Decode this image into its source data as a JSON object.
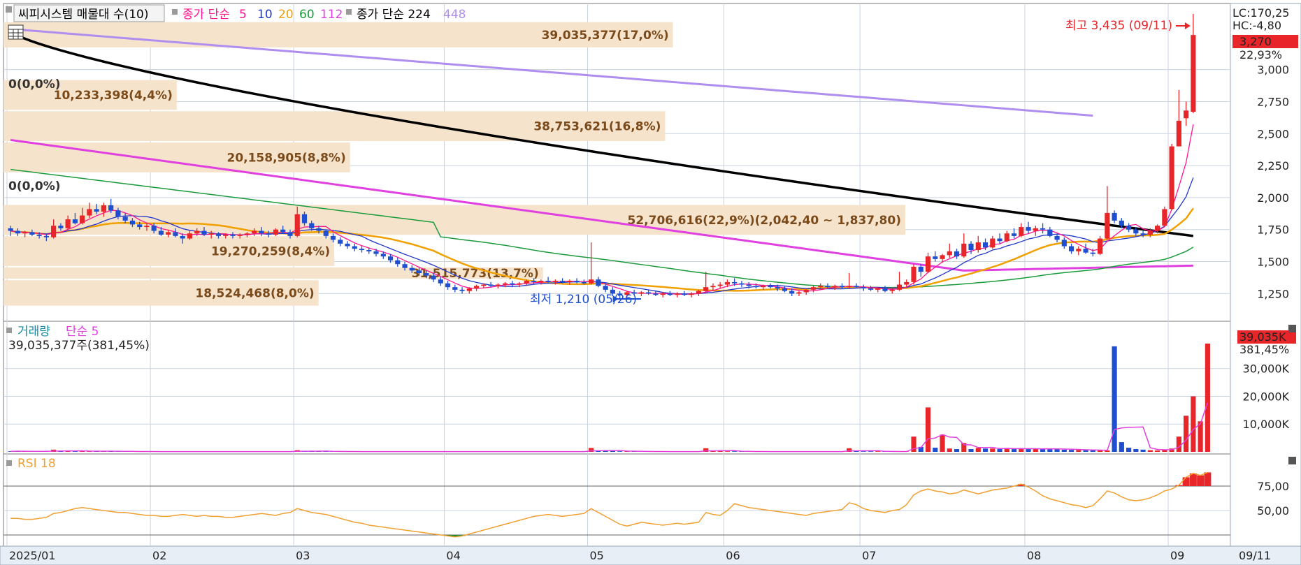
{
  "colors": {
    "up": "#e8262a",
    "down": "#1f4fd1",
    "ma5": "#ff1493",
    "ma10": "#2036c9",
    "ma20": "#f0a000",
    "ma60": "#1a9a3a",
    "ma112": "#e040e0",
    "ma224": "#000000",
    "ma448": "#b08ef0",
    "volume_band": "#f6e3cc",
    "volume_band_text": "#7a4a1a",
    "grid": "#c9d3e0",
    "panel_border": "#7a7a7a",
    "rsi_line": "#f0a030",
    "rsi_overbought": "#e8262a",
    "rsi_oversold": "#1a8a2a",
    "vol_ma": "#e040e0"
  },
  "legend": {
    "indicator": "씨피시스템 매물대 수(10)",
    "ma_prefix": "종가 단순",
    "ma5": "5",
    "ma10": "10",
    "ma20": "20",
    "ma60": "60",
    "ma112": "112",
    "ma224_label": "종가 단순 224",
    "ma448": "448"
  },
  "axis_info": {
    "lc": "LC:170,25",
    "hc": "HC:-4,80",
    "last_price": "3,270",
    "last_change": "22,93%",
    "last_volume": "39,035K",
    "last_volume_ratio": "381,45%"
  },
  "annotations": {
    "high": "최고 3,435 (09/11)",
    "low": "최저 1,210 (05/26)",
    "zero1": "0(0,0%)",
    "zero2": "0(0,0%)"
  },
  "volume_panel": {
    "title_a": "거래량",
    "title_b": "단순 5",
    "summary": "39,035,377주(381,45%)"
  },
  "rsi_panel": {
    "title": "RSI 18"
  },
  "date_label": "09/11",
  "chart_data": {
    "type": "candlestick",
    "ylim": [
      1050,
      3500
    ],
    "y_ticks": [
      "1,250",
      "1,500",
      "1,750",
      "2,000",
      "2,250",
      "2,500",
      "2,750",
      "3,000"
    ],
    "x_ticks": [
      "2025/01",
      "02",
      "03",
      "04",
      "05",
      "06",
      "07",
      "08",
      "09"
    ],
    "x_tick_days": [
      0,
      20,
      40,
      61,
      81,
      100,
      119,
      142,
      162
    ],
    "volume_profile": [
      {
        "lo": 3168,
        "hi": 3376,
        "label": "39,035,377(17,0%)",
        "pct": 17.0
      },
      {
        "lo": 2924,
        "hi": 3168,
        "label": "0(0,0%)",
        "pct": 0.0
      },
      {
        "lo": 2680,
        "hi": 2924,
        "label": "10,233,398(4,4%)",
        "pct": 4.4
      },
      {
        "lo": 2436,
        "hi": 2680,
        "label": "38,753,621(16,8%)",
        "pct": 16.8
      },
      {
        "lo": 2192,
        "hi": 2436,
        "label": "20,158,905(8,8%)",
        "pct": 8.8
      },
      {
        "lo": 1948,
        "hi": 2192,
        "label": "0(0,0%)",
        "pct": 0.0
      },
      {
        "lo": 1704,
        "hi": 1948,
        "label": "52,706,616(22,9%)(2,042,40 ~ 1,837,80)",
        "pct": 22.9
      },
      {
        "lo": 1460,
        "hi": 1704,
        "label": "19,270,259(8,4%)",
        "pct": 8.4
      },
      {
        "lo": 1360,
        "hi": 1460,
        "label": "31,515,773(13,7%)",
        "pct": 13.7
      },
      {
        "lo": 1150,
        "hi": 1360,
        "label": "18,524,468(8,0%)",
        "pct": 8.0
      }
    ],
    "ohlc_daily": [
      [
        1760,
        1780,
        1700,
        1740
      ],
      [
        1740,
        1760,
        1700,
        1720
      ],
      [
        1720,
        1740,
        1690,
        1730
      ],
      [
        1730,
        1750,
        1700,
        1710
      ],
      [
        1710,
        1730,
        1680,
        1700
      ],
      [
        1700,
        1720,
        1660,
        1690
      ],
      [
        1690,
        1830,
        1680,
        1780
      ],
      [
        1780,
        1800,
        1740,
        1760
      ],
      [
        1760,
        1860,
        1750,
        1830
      ],
      [
        1830,
        1880,
        1790,
        1800
      ],
      [
        1800,
        1920,
        1790,
        1860
      ],
      [
        1860,
        1960,
        1840,
        1910
      ],
      [
        1910,
        1950,
        1870,
        1890
      ],
      [
        1890,
        1960,
        1850,
        1940
      ],
      [
        1940,
        1990,
        1880,
        1900
      ],
      [
        1900,
        1920,
        1830,
        1850
      ],
      [
        1850,
        1880,
        1800,
        1820
      ],
      [
        1820,
        1840,
        1770,
        1790
      ],
      [
        1790,
        1810,
        1750,
        1770
      ],
      [
        1770,
        1800,
        1740,
        1780
      ],
      [
        1780,
        1800,
        1720,
        1740
      ],
      [
        1740,
        1770,
        1700,
        1710
      ],
      [
        1710,
        1750,
        1690,
        1730
      ],
      [
        1730,
        1760,
        1690,
        1700
      ],
      [
        1700,
        1720,
        1640,
        1680
      ],
      [
        1680,
        1740,
        1670,
        1720
      ],
      [
        1720,
        1760,
        1700,
        1740
      ],
      [
        1740,
        1770,
        1700,
        1710
      ],
      [
        1710,
        1740,
        1680,
        1720
      ],
      [
        1720,
        1730,
        1680,
        1700
      ],
      [
        1700,
        1720,
        1680,
        1710
      ],
      [
        1710,
        1730,
        1680,
        1700
      ],
      [
        1700,
        1720,
        1680,
        1710
      ],
      [
        1710,
        1730,
        1690,
        1720
      ],
      [
        1720,
        1760,
        1700,
        1740
      ],
      [
        1740,
        1770,
        1700,
        1720
      ],
      [
        1720,
        1740,
        1690,
        1710
      ],
      [
        1710,
        1760,
        1700,
        1750
      ],
      [
        1750,
        1780,
        1720,
        1730
      ],
      [
        1730,
        1750,
        1680,
        1700
      ],
      [
        1700,
        1930,
        1690,
        1870
      ],
      [
        1870,
        1890,
        1780,
        1800
      ],
      [
        1800,
        1820,
        1740,
        1760
      ],
      [
        1760,
        1780,
        1720,
        1740
      ],
      [
        1740,
        1750,
        1680,
        1700
      ],
      [
        1700,
        1720,
        1650,
        1670
      ],
      [
        1670,
        1690,
        1620,
        1640
      ],
      [
        1640,
        1660,
        1600,
        1620
      ],
      [
        1620,
        1640,
        1580,
        1600
      ],
      [
        1600,
        1620,
        1570,
        1590
      ],
      [
        1590,
        1610,
        1560,
        1580
      ],
      [
        1580,
        1600,
        1540,
        1560
      ],
      [
        1560,
        1580,
        1520,
        1540
      ],
      [
        1540,
        1560,
        1490,
        1510
      ],
      [
        1510,
        1530,
        1460,
        1480
      ],
      [
        1480,
        1500,
        1430,
        1450
      ],
      [
        1450,
        1470,
        1410,
        1430
      ],
      [
        1430,
        1450,
        1390,
        1410
      ],
      [
        1410,
        1430,
        1370,
        1390
      ],
      [
        1390,
        1410,
        1340,
        1360
      ],
      [
        1360,
        1380,
        1310,
        1330
      ],
      [
        1330,
        1350,
        1280,
        1300
      ],
      [
        1300,
        1320,
        1260,
        1280
      ],
      [
        1280,
        1300,
        1250,
        1270
      ],
      [
        1270,
        1300,
        1250,
        1290
      ],
      [
        1290,
        1320,
        1270,
        1310
      ],
      [
        1310,
        1330,
        1290,
        1320
      ],
      [
        1320,
        1340,
        1300,
        1310
      ],
      [
        1310,
        1330,
        1290,
        1320
      ],
      [
        1320,
        1340,
        1300,
        1330
      ],
      [
        1330,
        1350,
        1300,
        1320
      ],
      [
        1320,
        1340,
        1300,
        1330
      ],
      [
        1330,
        1360,
        1310,
        1350
      ],
      [
        1350,
        1370,
        1320,
        1340
      ],
      [
        1340,
        1360,
        1320,
        1350
      ],
      [
        1350,
        1380,
        1330,
        1340
      ],
      [
        1340,
        1360,
        1320,
        1350
      ],
      [
        1350,
        1370,
        1330,
        1340
      ],
      [
        1340,
        1360,
        1320,
        1350
      ],
      [
        1350,
        1370,
        1330,
        1340
      ],
      [
        1340,
        1360,
        1320,
        1330
      ],
      [
        1330,
        1650,
        1320,
        1360
      ],
      [
        1360,
        1380,
        1300,
        1310
      ],
      [
        1310,
        1330,
        1260,
        1280
      ],
      [
        1280,
        1300,
        1230,
        1250
      ],
      [
        1250,
        1270,
        1210,
        1240
      ],
      [
        1240,
        1270,
        1220,
        1260
      ],
      [
        1260,
        1280,
        1240,
        1250
      ],
      [
        1250,
        1270,
        1230,
        1260
      ],
      [
        1260,
        1280,
        1240,
        1250
      ],
      [
        1250,
        1270,
        1230,
        1240
      ],
      [
        1240,
        1260,
        1220,
        1250
      ],
      [
        1250,
        1270,
        1230,
        1240
      ],
      [
        1240,
        1260,
        1220,
        1250
      ],
      [
        1250,
        1270,
        1230,
        1240
      ],
      [
        1240,
        1260,
        1220,
        1250
      ],
      [
        1250,
        1280,
        1230,
        1270
      ],
      [
        1270,
        1420,
        1250,
        1300
      ],
      [
        1300,
        1330,
        1270,
        1310
      ],
      [
        1310,
        1340,
        1290,
        1320
      ],
      [
        1320,
        1360,
        1300,
        1340
      ],
      [
        1340,
        1370,
        1310,
        1330
      ],
      [
        1330,
        1350,
        1300,
        1320
      ],
      [
        1320,
        1340,
        1290,
        1310
      ],
      [
        1310,
        1330,
        1290,
        1300
      ],
      [
        1300,
        1320,
        1280,
        1310
      ],
      [
        1310,
        1330,
        1290,
        1300
      ],
      [
        1300,
        1320,
        1270,
        1290
      ],
      [
        1290,
        1310,
        1260,
        1270
      ],
      [
        1270,
        1290,
        1230,
        1250
      ],
      [
        1250,
        1270,
        1230,
        1260
      ],
      [
        1260,
        1290,
        1240,
        1280
      ],
      [
        1280,
        1310,
        1260,
        1300
      ],
      [
        1300,
        1330,
        1280,
        1310
      ],
      [
        1310,
        1330,
        1290,
        1300
      ],
      [
        1300,
        1320,
        1280,
        1310
      ],
      [
        1310,
        1330,
        1290,
        1300
      ],
      [
        1300,
        1410,
        1290,
        1310
      ],
      [
        1310,
        1330,
        1290,
        1300
      ],
      [
        1300,
        1320,
        1270,
        1290
      ],
      [
        1290,
        1310,
        1270,
        1280
      ],
      [
        1280,
        1300,
        1260,
        1290
      ],
      [
        1290,
        1310,
        1260,
        1270
      ],
      [
        1270,
        1290,
        1250,
        1280
      ],
      [
        1280,
        1420,
        1270,
        1320
      ],
      [
        1320,
        1360,
        1300,
        1340
      ],
      [
        1340,
        1480,
        1320,
        1460
      ],
      [
        1460,
        1480,
        1380,
        1420
      ],
      [
        1420,
        1570,
        1410,
        1540
      ],
      [
        1540,
        1580,
        1500,
        1520
      ],
      [
        1520,
        1560,
        1490,
        1550
      ],
      [
        1550,
        1640,
        1530,
        1580
      ],
      [
        1580,
        1600,
        1520,
        1540
      ],
      [
        1540,
        1720,
        1530,
        1640
      ],
      [
        1640,
        1660,
        1560,
        1590
      ],
      [
        1590,
        1700,
        1570,
        1650
      ],
      [
        1650,
        1680,
        1590,
        1610
      ],
      [
        1610,
        1700,
        1600,
        1680
      ],
      [
        1680,
        1720,
        1640,
        1660
      ],
      [
        1660,
        1740,
        1650,
        1720
      ],
      [
        1720,
        1760,
        1680,
        1700
      ],
      [
        1700,
        1800,
        1690,
        1770
      ],
      [
        1770,
        1810,
        1720,
        1740
      ],
      [
        1740,
        1780,
        1700,
        1760
      ],
      [
        1760,
        1800,
        1720,
        1750
      ],
      [
        1750,
        1770,
        1690,
        1700
      ],
      [
        1700,
        1720,
        1650,
        1670
      ],
      [
        1670,
        1690,
        1600,
        1620
      ],
      [
        1620,
        1640,
        1560,
        1580
      ],
      [
        1580,
        1620,
        1550,
        1600
      ],
      [
        1600,
        1640,
        1560,
        1570
      ],
      [
        1570,
        1600,
        1540,
        1560
      ],
      [
        1560,
        1700,
        1550,
        1680
      ],
      [
        1680,
        2090,
        1670,
        1880
      ],
      [
        1880,
        1900,
        1800,
        1820
      ],
      [
        1820,
        1840,
        1760,
        1780
      ],
      [
        1780,
        1800,
        1730,
        1750
      ],
      [
        1750,
        1770,
        1700,
        1720
      ],
      [
        1720,
        1740,
        1690,
        1710
      ],
      [
        1710,
        1760,
        1690,
        1740
      ],
      [
        1740,
        1790,
        1720,
        1780
      ],
      [
        1780,
        1930,
        1770,
        1910
      ],
      [
        1910,
        2420,
        1900,
        2400
      ],
      [
        2400,
        2840,
        2500,
        2600
      ],
      [
        2620,
        2750,
        2560,
        2680
      ],
      [
        2670,
        3435,
        2660,
        3270
      ]
    ],
    "volume_daily": [
      0.2,
      0.3,
      0.2,
      0.1,
      0.2,
      0.1,
      0.8,
      0.3,
      0.3,
      0.2,
      0.3,
      0.3,
      0.2,
      0.3,
      0.2,
      0.1,
      0.2,
      0.1,
      0.1,
      0.1,
      0.1,
      0.1,
      0.1,
      0.1,
      0.1,
      0.1,
      0.1,
      0.1,
      0.1,
      0.1,
      0.1,
      0.1,
      0.1,
      0.1,
      0.1,
      0.1,
      0.1,
      0.1,
      0.1,
      0.1,
      0.6,
      0.2,
      0.2,
      0.2,
      0.2,
      0.1,
      0.1,
      0.1,
      0.1,
      0.1,
      0.1,
      0.1,
      0.1,
      0.1,
      0.1,
      0.1,
      0.1,
      0.1,
      0.1,
      0.1,
      0.1,
      0.1,
      0.1,
      0.1,
      0.1,
      0.1,
      0.1,
      0.1,
      0.1,
      0.1,
      0.1,
      0.1,
      0.1,
      0.1,
      0.1,
      0.1,
      0.1,
      0.1,
      0.1,
      0.1,
      0.1,
      1.4,
      0.4,
      0.3,
      0.3,
      0.2,
      0.2,
      0.2,
      0.1,
      0.1,
      0.1,
      0.1,
      0.1,
      0.1,
      0.1,
      0.1,
      0.1,
      1.3,
      0.3,
      0.3,
      0.2,
      0.2,
      0.1,
      0.1,
      0.1,
      0.1,
      0.1,
      0.1,
      0.1,
      0.1,
      0.1,
      0.1,
      0.1,
      0.1,
      0.1,
      0.1,
      0.1,
      1.3,
      0.3,
      0.2,
      0.2,
      0.2,
      0.1,
      0.1,
      0.1,
      0.1,
      5.5,
      1.8,
      16.0,
      1.5,
      6.2,
      1.2,
      1.0,
      3.2,
      1.0,
      1.4,
      1.2,
      1.2,
      1.0,
      1.4,
      1.0,
      1.2,
      1.0,
      1.1,
      1.0,
      1.2,
      1.0,
      0.8,
      0.7,
      0.7,
      0.6,
      0.6,
      0.5,
      0.5,
      38.0,
      3.5,
      1.5,
      1.0,
      0.8,
      0.6,
      0.5,
      0.8,
      1.2,
      5.5,
      13.0,
      20.0,
      11.0,
      39.0
    ],
    "rsi_daily": [
      42,
      42,
      41,
      41,
      42,
      43,
      47,
      48,
      50,
      52,
      53,
      52,
      51,
      50,
      49,
      48,
      48,
      47,
      46,
      45,
      45,
      44,
      44,
      45,
      46,
      45,
      44,
      45,
      44,
      44,
      43,
      43,
      44,
      45,
      46,
      47,
      46,
      45,
      47,
      48,
      52,
      50,
      48,
      47,
      46,
      44,
      42,
      40,
      38,
      37,
      35,
      34,
      33,
      32,
      31,
      30,
      29,
      28,
      27,
      26,
      25,
      24,
      23,
      24,
      26,
      28,
      30,
      32,
      34,
      36,
      38,
      40,
      42,
      44,
      45,
      46,
      45,
      44,
      45,
      46,
      47,
      52,
      48,
      44,
      40,
      36,
      34,
      36,
      38,
      37,
      36,
      35,
      36,
      37,
      36,
      37,
      38,
      48,
      46,
      45,
      50,
      57,
      55,
      53,
      52,
      51,
      50,
      49,
      48,
      47,
      46,
      45,
      47,
      48,
      49,
      50,
      51,
      58,
      56,
      52,
      50,
      49,
      48,
      50,
      51,
      56,
      66,
      70,
      72,
      70,
      69,
      67,
      68,
      71,
      69,
      67,
      69,
      71,
      72,
      73,
      75,
      77,
      74,
      70,
      65,
      62,
      60,
      58,
      56,
      55,
      53,
      55,
      62,
      70,
      68,
      64,
      61,
      60,
      61,
      63,
      66,
      70,
      72,
      76,
      84,
      88,
      86,
      89
    ]
  }
}
